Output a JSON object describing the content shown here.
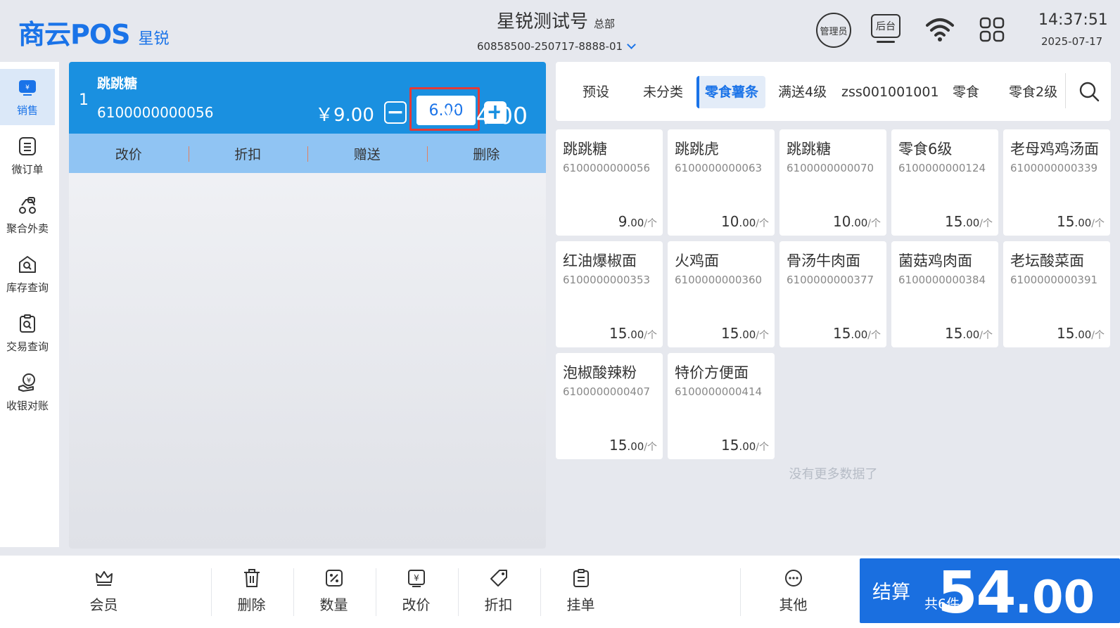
{
  "header": {
    "logo_main": "商云POS",
    "logo_sub": "星锐",
    "store_name": "星锐测试号",
    "store_tag": "总部",
    "store_id": "60858500-250717-8888-01",
    "admin_label": "管理员",
    "backend_label": "后台",
    "time": "14:37:51",
    "date": "2025-07-17"
  },
  "sidebar": {
    "items": [
      {
        "label": "销售",
        "icon": "sales-icon",
        "active": true
      },
      {
        "label": "微订单",
        "icon": "order-icon"
      },
      {
        "label": "聚合外卖",
        "icon": "delivery-icon"
      },
      {
        "label": "库存查询",
        "icon": "inventory-icon"
      },
      {
        "label": "交易查询",
        "icon": "transaction-icon"
      },
      {
        "label": "收银对账",
        "icon": "reconcile-icon"
      }
    ]
  },
  "cart": {
    "line": {
      "index": "1",
      "name": "跳跳糖",
      "code": "6100000000056",
      "unit_price": "￥9.00",
      "qty": "6.00",
      "total": "￥54.00"
    },
    "actions": [
      "改价",
      "折扣",
      "赠送",
      "删除"
    ]
  },
  "categories": [
    {
      "label": "预设"
    },
    {
      "label": "未分类"
    },
    {
      "label": "零食薯条",
      "active": true
    },
    {
      "label": "满送4级"
    },
    {
      "label": "zss001001001"
    },
    {
      "label": "零食"
    },
    {
      "label": "零食2级"
    }
  ],
  "products": [
    {
      "name": "跳跳糖",
      "code": "6100000000056",
      "price_int": "9",
      "price_dec": ".00",
      "unit": "/个"
    },
    {
      "name": "跳跳虎",
      "code": "6100000000063",
      "price_int": "10",
      "price_dec": ".00",
      "unit": "/个"
    },
    {
      "name": "跳跳糖",
      "code": "6100000000070",
      "price_int": "10",
      "price_dec": ".00",
      "unit": "/个"
    },
    {
      "name": "零食6级",
      "code": "6100000000124",
      "price_int": "15",
      "price_dec": ".00",
      "unit": "/个"
    },
    {
      "name": "老母鸡鸡汤面",
      "code": "6100000000339",
      "price_int": "15",
      "price_dec": ".00",
      "unit": "/个"
    },
    {
      "name": "红油爆椒面",
      "code": "6100000000353",
      "price_int": "15",
      "price_dec": ".00",
      "unit": "/个"
    },
    {
      "name": "火鸡面",
      "code": "6100000000360",
      "price_int": "15",
      "price_dec": ".00",
      "unit": "/个"
    },
    {
      "name": "骨汤牛肉面",
      "code": "6100000000377",
      "price_int": "15",
      "price_dec": ".00",
      "unit": "/个"
    },
    {
      "name": "菌菇鸡肉面",
      "code": "6100000000384",
      "price_int": "15",
      "price_dec": ".00",
      "unit": "/个"
    },
    {
      "name": "老坛酸菜面",
      "code": "6100000000391",
      "price_int": "15",
      "price_dec": ".00",
      "unit": "/个"
    },
    {
      "name": "泡椒酸辣粉",
      "code": "6100000000407",
      "price_int": "15",
      "price_dec": ".00",
      "unit": "/个"
    },
    {
      "name": "特价方便面",
      "code": "6100000000414",
      "price_int": "15",
      "price_dec": ".00",
      "unit": "/个"
    }
  ],
  "no_more_text": "没有更多数据了",
  "footer": {
    "buttons": [
      {
        "label": "会员",
        "icon": "member-crown-icon"
      },
      {
        "label": "删除",
        "icon": "trash-icon"
      },
      {
        "label": "数量",
        "icon": "quantity-icon"
      },
      {
        "label": "改价",
        "icon": "price-change-icon"
      },
      {
        "label": "折扣",
        "icon": "discount-tag-icon"
      },
      {
        "label": "挂单",
        "icon": "hold-order-icon"
      },
      {
        "label": "其他",
        "icon": "more-icon"
      }
    ],
    "checkout": {
      "label": "结算",
      "count": "共6件",
      "amount_int": "54",
      "amount_dec": ".00"
    }
  },
  "colors": {
    "accent": "#1a73e8",
    "cart_line_bg": "#1a90e0",
    "cart_actions_bg": "#90c4f3",
    "checkout_bg": "#1a6fe0",
    "qty_highlight": "#e53935"
  }
}
